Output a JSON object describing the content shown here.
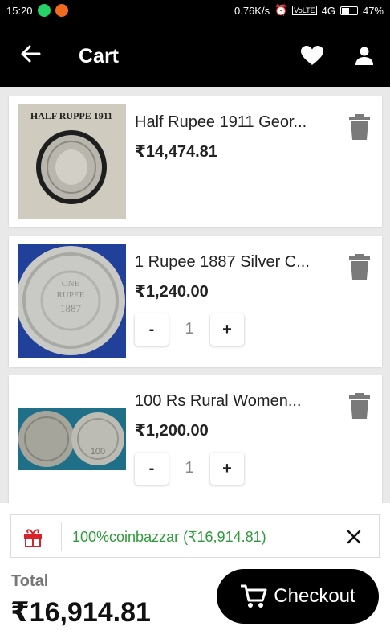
{
  "status_bar": {
    "time": "15:20",
    "network_speed": "0.76K/s",
    "network_type": "4G",
    "volte": "VoLTE",
    "battery": "47%"
  },
  "app_bar": {
    "title": "Cart",
    "back_icon": "arrow-left-icon",
    "favorites_icon": "heart-icon",
    "account_icon": "person-icon"
  },
  "cart": {
    "items": [
      {
        "name": "Half Rupee 1911 Geor...",
        "price": "₹14,474.81",
        "image_label": "HALF RUPPE 1911"
      },
      {
        "name": "1 Rupee 1887 Silver C...",
        "price": "₹1,240.00",
        "quantity": "1",
        "qty_minus": "-",
        "qty_plus": "+"
      },
      {
        "name": "100 Rs Rural Women...",
        "price": "₹1,200.00",
        "quantity": "1",
        "qty_minus": "-",
        "qty_plus": "+"
      }
    ]
  },
  "coupon": {
    "text": "100%coinbazzar (₹16,914.81)",
    "icon": "gift-icon",
    "color": "#2e9a3a"
  },
  "summary": {
    "total_label": "Total",
    "total_value": "₹16,914.81",
    "checkout_label": "Checkout",
    "checkout_icon": "cart-icon"
  }
}
